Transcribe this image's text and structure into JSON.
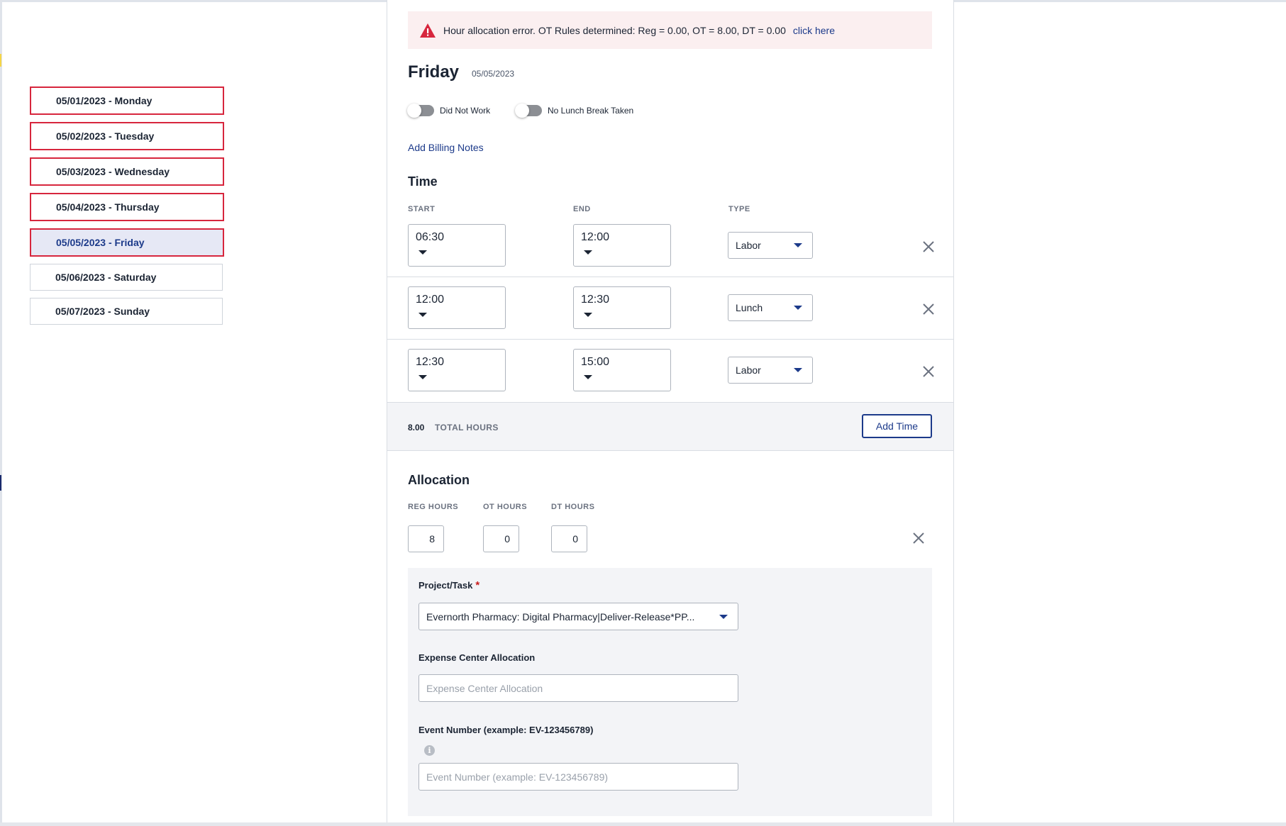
{
  "days": [
    {
      "label": "05/01/2023 - Monday",
      "status": "error"
    },
    {
      "label": "05/02/2023 - Tuesday",
      "status": "error"
    },
    {
      "label": "05/03/2023 - Wednesday",
      "status": "error"
    },
    {
      "label": "05/04/2023 - Thursday",
      "status": "error"
    },
    {
      "label": "05/05/2023 - Friday",
      "status": "error-active"
    },
    {
      "label": "05/06/2023 - Saturday",
      "status": "ok"
    },
    {
      "label": "05/07/2023 - Sunday",
      "status": "ok"
    }
  ],
  "alert": {
    "message": "Hour allocation error. OT Rules determined: Reg = 0.00, OT = 8.00, DT = 0.00",
    "link": "click here",
    "icon": "warning-triangle-icon",
    "color": "#d7263d"
  },
  "day": {
    "name": "Friday",
    "date": "05/05/2023"
  },
  "toggles": {
    "did_not_work": "Did Not Work",
    "no_lunch": "No Lunch Break Taken"
  },
  "billing_link": "Add Billing Notes",
  "time_section": {
    "title": "Time",
    "col_start": "START",
    "col_end": "END",
    "col_type": "TYPE",
    "rows": [
      {
        "start": "06:30",
        "end": "12:00",
        "type": "Labor"
      },
      {
        "start": "12:00",
        "end": "12:30",
        "type": "Lunch"
      },
      {
        "start": "12:30",
        "end": "15:00",
        "type": "Labor"
      }
    ],
    "total_value": "8.00",
    "total_label": "TOTAL HOURS",
    "add_time": "Add Time"
  },
  "allocation": {
    "title": "Allocation",
    "reg_label": "REG HOURS",
    "ot_label": "OT HOURS",
    "dt_label": "DT HOURS",
    "reg": "8",
    "ot": "0",
    "dt": "0",
    "project_label": "Project/Task",
    "required_mark": "*",
    "project_value": "Evernorth Pharmacy: Digital Pharmacy|Deliver-Release*PP...",
    "expense_label": "Expense Center Allocation",
    "expense_placeholder": "Expense Center Allocation",
    "event_label": "Event Number (example: EV-123456789)",
    "event_placeholder": "Event Number (example: EV-123456789)"
  },
  "colors": {
    "accent": "#1c3a8a",
    "error": "#d7263d",
    "active_bg": "#e6e8f5"
  }
}
